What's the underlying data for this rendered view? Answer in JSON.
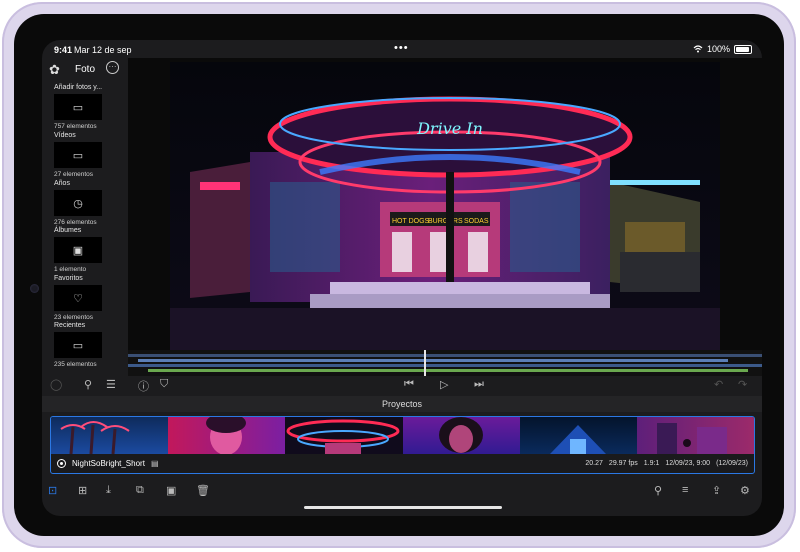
{
  "status": {
    "time": "9:41",
    "date": "Mar 12 de sep",
    "battery": "100%"
  },
  "sidebar": {
    "title": "Foto",
    "items": [
      {
        "label": "Añadir fotos y...",
        "count": "757 elementos",
        "icon": "folder-icon",
        "glyph": "▭"
      },
      {
        "label": "Vídeos",
        "count": "27 elementos",
        "icon": "video-icon",
        "glyph": "▭"
      },
      {
        "label": "Años",
        "count": "276 elementos",
        "icon": "calendar-icon",
        "glyph": "◷"
      },
      {
        "label": "Álbumes",
        "count": "1 elemento",
        "icon": "album-icon",
        "glyph": "▣"
      },
      {
        "label": "Favoritos",
        "count": "23 elementos",
        "icon": "heart-icon",
        "glyph": "♡"
      },
      {
        "label": "Recientes",
        "count": "235 elementos",
        "icon": "folder-icon",
        "glyph": "▭"
      }
    ]
  },
  "photo": {
    "sign_text": "Drive In",
    "shop_signs": [
      "HOT DOGS",
      "BURGERS",
      "SODAS"
    ]
  },
  "projects": {
    "title": "Proyectos",
    "project_name": "NightSoBright_Short",
    "duration": "20.27",
    "fps": "29.97 fps",
    "ratio": "1.9:1",
    "modified": "12/09/23, 9:00",
    "created": "(12/09/23)"
  },
  "colors": {
    "accent": "#2b78e4",
    "bg": "#1c1c1e"
  }
}
